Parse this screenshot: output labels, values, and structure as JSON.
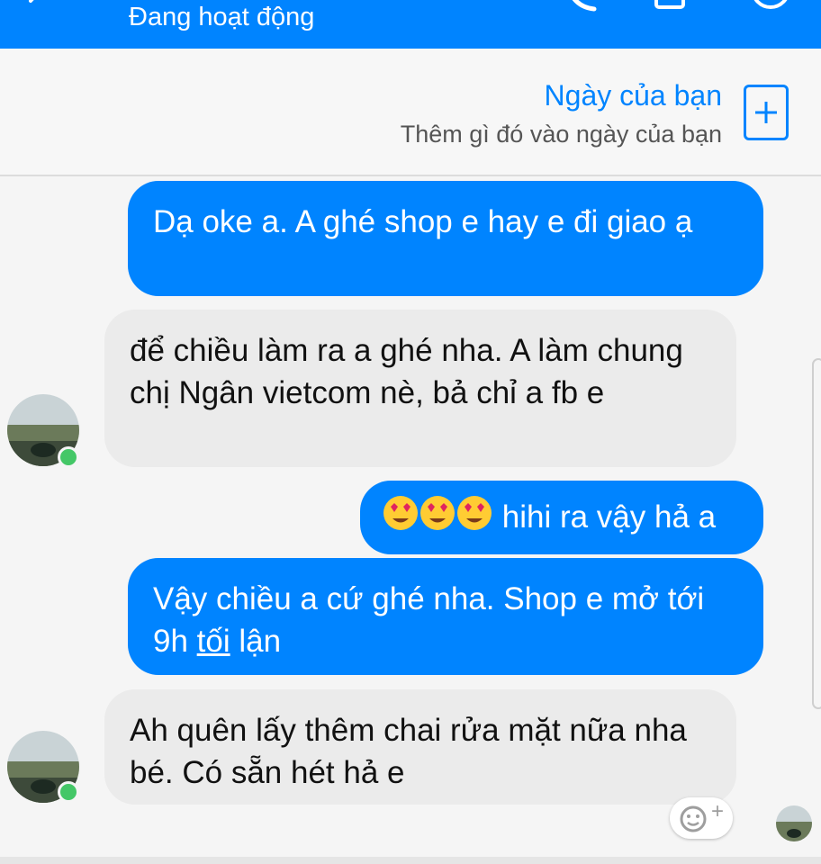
{
  "header": {
    "status": "Đang hoạt động",
    "accent": "#0084ff"
  },
  "your_day": {
    "title": "Ngày của bạn",
    "subtitle": "Thêm gì đó vào ngày của bạn",
    "add_icon": "plus-icon"
  },
  "messages": [
    {
      "from": "me",
      "text": "Dạ oke a. A ghé shop e hay e đi giao ạ"
    },
    {
      "from": "them",
      "text": "để chiều làm ra a ghé nha. A làm chung chị Ngân vietcom nè, bả chỉ a fb e"
    },
    {
      "from": "me",
      "emoji": "heart-eyes-emoji ×3",
      "text": "hihi ra vậy hả a"
    },
    {
      "from": "me",
      "text_before": "Vậy chiều a cứ ghé nha. Shop e mở tới 9h ",
      "text_link": "tối",
      "text_after": " lận"
    },
    {
      "from": "them",
      "text": "Ah quên lấy thêm chai rửa mặt nữa nha bé. Có sẵn hét hả e"
    }
  ],
  "react_button": {
    "icon": "smiley-add-icon",
    "plus": "+"
  },
  "colors": {
    "outgoing": "#0084ff",
    "incoming": "#ebebeb",
    "online": "#44c767"
  }
}
